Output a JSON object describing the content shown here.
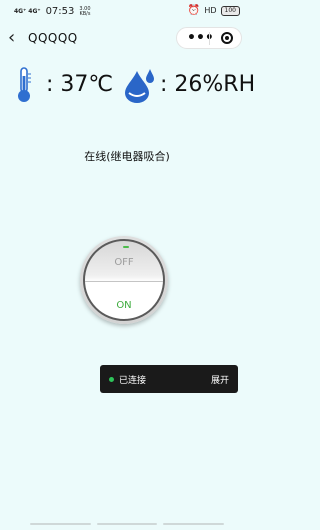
{
  "status_bar": {
    "signal_1": "4G⁺",
    "signal_2": "4G⁺",
    "time": "07:53",
    "net_speed_value": "3.00",
    "net_speed_unit": "KB/s",
    "alarm_icon": "alarm-clock-icon",
    "hd_label": "HD",
    "battery": "100"
  },
  "nav": {
    "back_icon": "chevron-left-icon",
    "title": "QQQQQ",
    "more_icon": "more-dots-icon",
    "close_icon": "target-circle-icon"
  },
  "sensors": {
    "temperature_icon": "thermometer-icon",
    "temperature_text": ": 37℃",
    "humidity_icon": "water-drop-icon",
    "humidity_text": ": 26%RH"
  },
  "device": {
    "status": "在线(继电器吸合)"
  },
  "switch": {
    "off_label": "OFF",
    "on_label": "ON",
    "state": "on",
    "indicator_color": "#4cbb4c"
  },
  "toast": {
    "status": "已连接",
    "expand": "展开",
    "dot_color": "#2ec45a"
  },
  "colors": {
    "background": "#ecfbfb",
    "thermo_blue": "#2f6fd0",
    "drop_blue": "#2a66c8",
    "on_green": "#3dab3d"
  }
}
